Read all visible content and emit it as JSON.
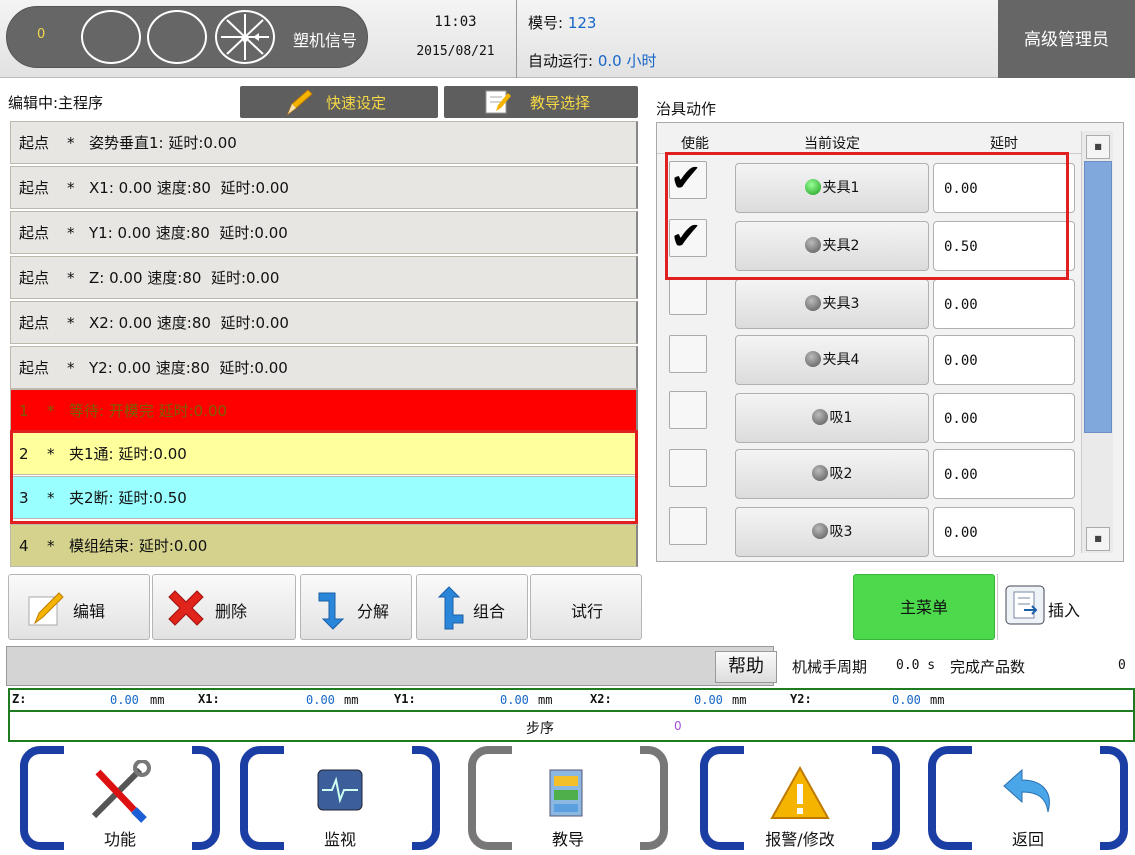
{
  "top": {
    "counter": "0",
    "signal_label": "塑机信号",
    "time": "11:03",
    "date": "2015/08/21",
    "mold_label": "模号:",
    "mold_value": "123",
    "autorun_label": "自动运行:",
    "autorun_value": "0.0",
    "autorun_unit": "小时",
    "user": "高级管理员"
  },
  "editor": {
    "status": "编辑中:主程序",
    "quick_set": "快速设定",
    "teach_select": "教导选择"
  },
  "program_rows": [
    {
      "step": "起点",
      "mark": "*",
      "text": "姿势垂直1: 延时:0.00"
    },
    {
      "step": "起点",
      "mark": "*",
      "text": "X1: 0.00 速度:80  延时:0.00"
    },
    {
      "step": "起点",
      "mark": "*",
      "text": "Y1: 0.00 速度:80  延时:0.00"
    },
    {
      "step": "起点",
      "mark": "*",
      "text": "Z: 0.00 速度:80  延时:0.00"
    },
    {
      "step": "起点",
      "mark": "*",
      "text": "X2: 0.00 速度:80  延时:0.00"
    },
    {
      "step": "起点",
      "mark": "*",
      "text": "Y2: 0.00 速度:80  延时:0.00"
    },
    {
      "step": "1",
      "mark": "*",
      "text": "等待: 开模完 延时:0.00"
    },
    {
      "step": "2",
      "mark": "*",
      "text": "夹1通: 延时:0.00"
    },
    {
      "step": "3",
      "mark": "*",
      "text": "夹2断: 延时:0.50"
    },
    {
      "step": "4",
      "mark": "*",
      "text": "模组结束: 延时:0.00"
    }
  ],
  "fixture": {
    "title": "治具动作",
    "col_enable": "使能",
    "col_current": "当前设定",
    "col_delay": "延时",
    "rows": [
      {
        "checked": true,
        "label": "夹具1",
        "active": true,
        "delay": "0.00"
      },
      {
        "checked": true,
        "label": "夹具2",
        "active": false,
        "delay": "0.50"
      },
      {
        "checked": false,
        "label": "夹具3",
        "active": false,
        "delay": "0.00"
      },
      {
        "checked": false,
        "label": "夹具4",
        "active": false,
        "delay": "0.00"
      },
      {
        "checked": false,
        "label": "吸1",
        "active": false,
        "delay": "0.00"
      },
      {
        "checked": false,
        "label": "吸2",
        "active": false,
        "delay": "0.00"
      },
      {
        "checked": false,
        "label": "吸3",
        "active": false,
        "delay": "0.00"
      }
    ],
    "checkmark": "✔",
    "scroll_btn": "■"
  },
  "actions": {
    "edit": "编辑",
    "delete": "删除",
    "split": "分解",
    "combine": "组合",
    "trial": "试行",
    "main_menu": "主菜单",
    "insert": "插入"
  },
  "status": {
    "help": "帮助",
    "cycle_label": "机械手周期",
    "cycle_value": "0.0 s",
    "done_label": "完成产品数",
    "done_value": "0"
  },
  "coords": {
    "z_label": "Z:",
    "z_value": "0.00",
    "z_unit": "mm",
    "x1_label": "X1:",
    "x1_value": "0.00",
    "x1_unit": "mm",
    "y1_label": "Y1:",
    "y1_value": "0.00",
    "y1_unit": "mm",
    "x2_label": "X2:",
    "x2_value": "0.00",
    "x2_unit": "mm",
    "y2_label": "Y2:",
    "y2_value": "0.00",
    "y2_unit": "mm",
    "step_label": "步序",
    "step_value": "0"
  },
  "nav": {
    "function": "功能",
    "monitor": "监视",
    "teach": "教导",
    "alarm": "报警/修改",
    "back": "返回"
  }
}
